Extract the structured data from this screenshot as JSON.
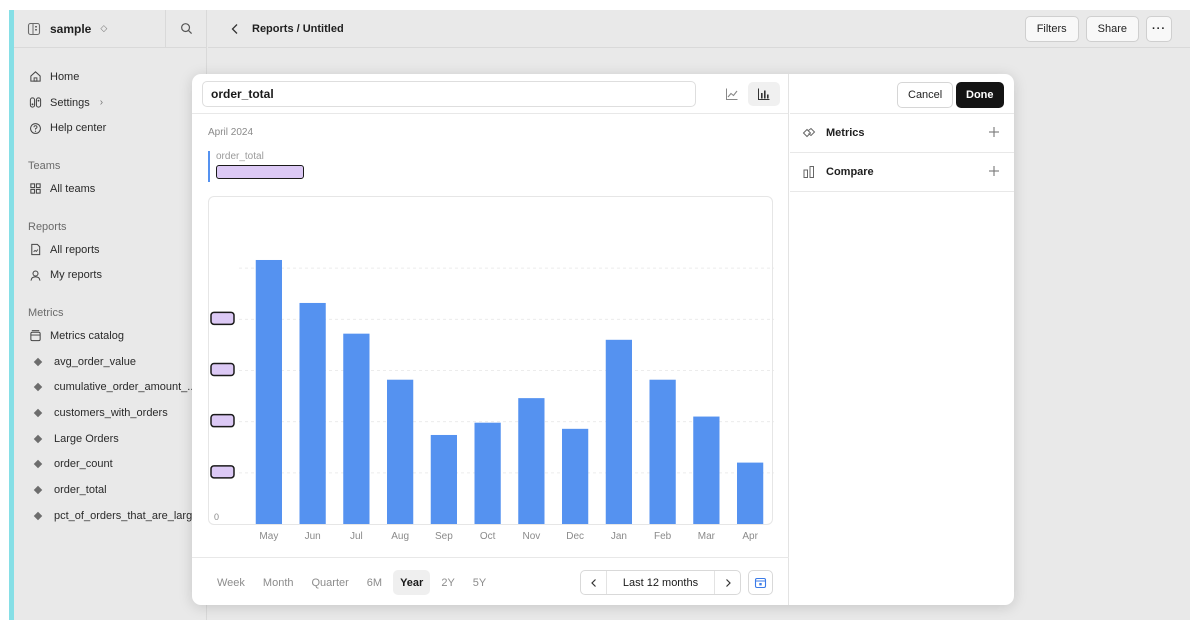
{
  "workspace": {
    "name": "sample"
  },
  "breadcrumb": "Reports / Untitled",
  "toolbar": {
    "filters": "Filters",
    "share": "Share",
    "more": "···"
  },
  "sidebar": {
    "top_items": [
      {
        "label": "Home",
        "icon": "home-icon"
      },
      {
        "label": "Settings",
        "icon": "settings-icon"
      },
      {
        "label": "Help center",
        "icon": "help-icon"
      }
    ],
    "sections": {
      "teams": {
        "title": "Teams",
        "items": [
          {
            "label": "All teams",
            "icon": "grid-icon"
          }
        ]
      },
      "reports": {
        "title": "Reports",
        "items": [
          {
            "label": "All reports",
            "icon": "report-icon"
          },
          {
            "label": "My reports",
            "icon": "user-icon"
          }
        ]
      },
      "metrics": {
        "title": "Metrics",
        "catalog": "Metrics catalog",
        "items": [
          "avg_order_value",
          "cumulative_order_amount_...",
          "customers_with_orders",
          "Large Orders",
          "order_count",
          "order_total",
          "pct_of_orders_that_are_large"
        ]
      }
    }
  },
  "editor": {
    "title_value": "order_total",
    "date_label": "April 2024",
    "legend_name": "order_total",
    "period_tabs": [
      "Week",
      "Month",
      "Quarter",
      "6M",
      "Year",
      "2Y",
      "5Y"
    ],
    "active_period": "Year",
    "range_label": "Last 12 months",
    "cancel": "Cancel",
    "done": "Done",
    "panel": [
      {
        "label": "Metrics",
        "icon": "metrics-icon"
      },
      {
        "label": "Compare",
        "icon": "compare-icon"
      }
    ]
  },
  "chart_data": {
    "type": "bar",
    "categories": [
      "May",
      "Jun",
      "Jul",
      "Aug",
      "Sep",
      "Oct",
      "Nov",
      "Dec",
      "Jan",
      "Feb",
      "Mar",
      "Apr"
    ],
    "values": [
      86,
      72,
      62,
      47,
      29,
      33,
      41,
      31,
      60,
      47,
      35,
      20
    ],
    "y_tick_labels": [
      "0"
    ],
    "ylim": [
      0,
      100
    ],
    "gridlines": 5,
    "bar_color": "#5592f0",
    "redacted_tick_labels": 4,
    "grid": true
  }
}
